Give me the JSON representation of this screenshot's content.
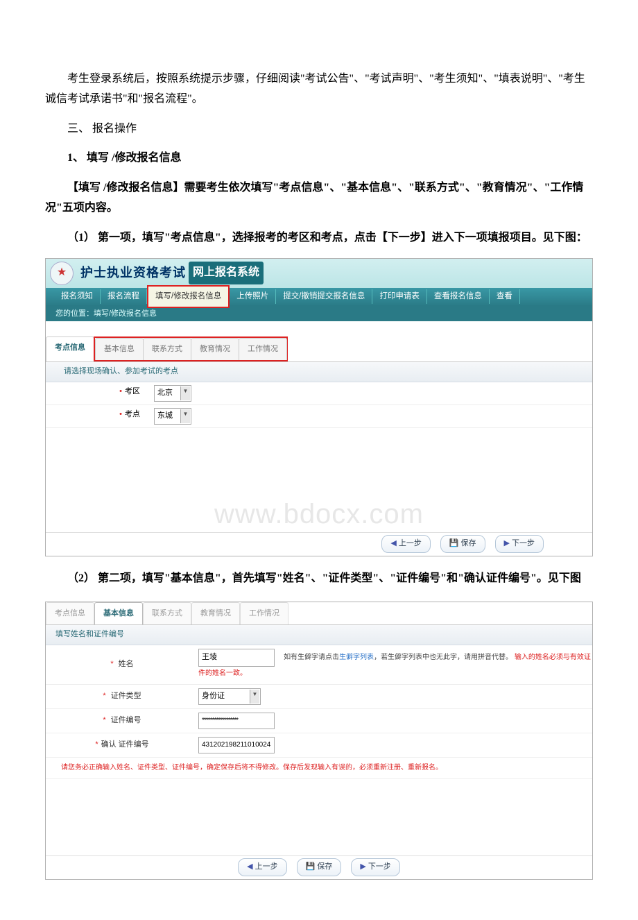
{
  "doc": {
    "p1": "考生登录系统后，按照系统提示步骤，仔细阅读\"考试公告\"、\"考试声明\"、\"考生须知\"、\"填表说明\"、\"考生诚信考试承诺书\"和\"报名流程\"。",
    "h3": "三、 报名操作",
    "h1": "1、 填写 /修改报名信息",
    "p2": "【填写 /修改报名信息】需要考生依次填写\"考点信息\"、\"基本信息\"、\"联系方式\"、\"教育情况\"、\"工作情况\"五项内容。",
    "p3": "（1） 第一项，填写\"考点信息\"，选择报考的考区和考点，点击【下一步】进入下一项填报项目。见下图：",
    "p4": "（2） 第二项，填写\"基本信息\"，首先填写\"姓名\"、\"证件类型\"、\"证件编号\"和\"确认证件编号\"。见下图"
  },
  "ss1": {
    "title_bold": "护士执业资格考试",
    "title_sub": "网上报名系统",
    "nav": {
      "item1": "报名须知",
      "item2": "报名流程",
      "item3": "填写/修改报名信息",
      "item4": "上传照片",
      "item5": "提交/撤销提交报名信息",
      "item6": "打印申请表",
      "item7": "查看报名信息",
      "item8": "查看"
    },
    "crumb": "您的位置：填写/修改报名信息",
    "tabs": {
      "t1": "考点信息",
      "t2": "基本信息",
      "t3": "联系方式",
      "t4": "教育情况",
      "t5": "工作情况"
    },
    "subhead": "请选择现场确认、参加考试的考点",
    "row1_label": "考区",
    "row1_value": "北京",
    "row2_label": "考点",
    "row2_value": "东城",
    "watermark": "www.bdocx.com",
    "btn_prev": "上一步",
    "btn_save": "保存",
    "btn_next": "下一步"
  },
  "ss2": {
    "tabs": {
      "t1": "考点信息",
      "t2": "基本信息",
      "t3": "联系方式",
      "t4": "教育情况",
      "t5": "工作情况"
    },
    "sub": "填写姓名和证件编号",
    "name_label": "姓名",
    "name_value": "王堎",
    "name_hint_pre": "如有生僻字请点击",
    "name_hint_link": "生僻字列表",
    "name_hint_mid": "，若生僻字列表中也无此字，请用拼音代替。",
    "name_hint_red": "输入的姓名必须与有效证件的姓名一致。",
    "type_label": "证件类型",
    "type_value": "身份证",
    "idno_label": "证件编号",
    "idno_value": "******************",
    "idno2_label": "确认 证件编号",
    "idno2_value": "431202198211010024",
    "warning": "请您务必正确输入姓名、证件类型、证件编号，确定保存后将不得修改。保存后发现输入有误的，必须重新注册、重新报名。",
    "btn_prev": "上一步",
    "btn_save": "保存",
    "btn_next": "下一步"
  }
}
